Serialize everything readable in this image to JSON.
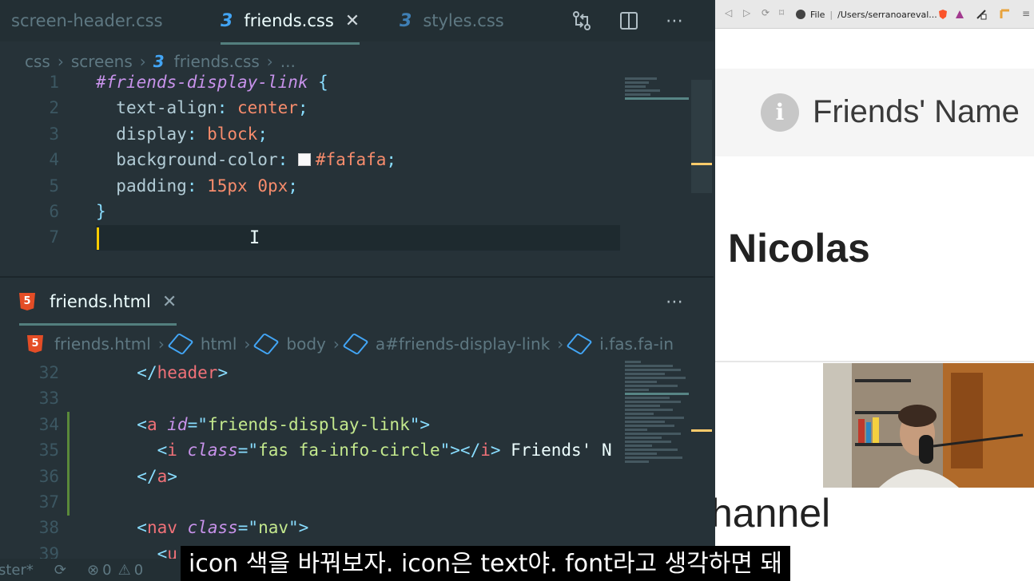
{
  "editor": {
    "tabs": [
      {
        "label": "screen-header.css",
        "active": false
      },
      {
        "label": "friends.css",
        "active": true
      },
      {
        "label": "styles.css",
        "active": false
      }
    ],
    "toolbar_icons": [
      "compare-icon",
      "split-editor-icon",
      "more-icon"
    ],
    "css_breadcrumb": [
      "css",
      "screens",
      "friends.css",
      "..."
    ],
    "css_lines": [
      {
        "n": "1",
        "parts": [
          [
            "sel",
            "#friends-display-link"
          ],
          [
            "pl",
            " "
          ],
          [
            "punc",
            "{"
          ]
        ]
      },
      {
        "n": "2",
        "parts": [
          [
            "pl",
            "  "
          ],
          [
            "prop",
            "text-align"
          ],
          [
            "punc",
            ": "
          ],
          [
            "val",
            "center"
          ],
          [
            "punc",
            ";"
          ]
        ]
      },
      {
        "n": "3",
        "parts": [
          [
            "pl",
            "  "
          ],
          [
            "prop",
            "display"
          ],
          [
            "punc",
            ": "
          ],
          [
            "val",
            "block"
          ],
          [
            "punc",
            ";"
          ]
        ]
      },
      {
        "n": "4",
        "parts": [
          [
            "pl",
            "  "
          ],
          [
            "prop",
            "background-color"
          ],
          [
            "punc",
            ": "
          ],
          [
            "swatch",
            ""
          ],
          [
            "val",
            "#fafafa"
          ],
          [
            "punc",
            ";"
          ]
        ]
      },
      {
        "n": "5",
        "parts": [
          [
            "pl",
            "  "
          ],
          [
            "prop",
            "padding"
          ],
          [
            "punc",
            ": "
          ],
          [
            "val",
            "15px 0px"
          ],
          [
            "punc",
            ";"
          ]
        ]
      },
      {
        "n": "6",
        "parts": [
          [
            "punc",
            "}"
          ]
        ]
      },
      {
        "n": "7",
        "parts": []
      }
    ],
    "html_panel_title": "friends.html",
    "html_breadcrumb": [
      "friends.html",
      "html",
      "body",
      "a#friends-display-link",
      "i.fas.fa-in"
    ],
    "html_lines": [
      {
        "n": "32",
        "parts": [
          [
            "pl",
            "  "
          ],
          [
            "punc",
            "</"
          ],
          [
            "tag",
            "header"
          ],
          [
            "punc",
            ">"
          ]
        ]
      },
      {
        "n": "33",
        "parts": []
      },
      {
        "n": "34",
        "parts": [
          [
            "pl",
            "  "
          ],
          [
            "punc",
            "<"
          ],
          [
            "tag",
            "a"
          ],
          [
            "pl",
            " "
          ],
          [
            "attr",
            "id"
          ],
          [
            "punc",
            "=\""
          ],
          [
            "str",
            "friends-display-link"
          ],
          [
            "punc",
            "\">"
          ]
        ]
      },
      {
        "n": "35",
        "parts": [
          [
            "pl",
            "    "
          ],
          [
            "punc",
            "<"
          ],
          [
            "tag",
            "i"
          ],
          [
            "pl",
            " "
          ],
          [
            "attr",
            "class"
          ],
          [
            "punc",
            "=\""
          ],
          [
            "str",
            "fas fa-info-circle"
          ],
          [
            "punc",
            "\"></"
          ],
          [
            "tag",
            "i"
          ],
          [
            "punc",
            ">"
          ],
          [
            "pl",
            " Friends' N"
          ]
        ]
      },
      {
        "n": "36",
        "parts": [
          [
            "pl",
            "  "
          ],
          [
            "punc",
            "</"
          ],
          [
            "tag",
            "a"
          ],
          [
            "punc",
            ">"
          ]
        ]
      },
      {
        "n": "37",
        "parts": []
      },
      {
        "n": "38",
        "parts": [
          [
            "pl",
            "  "
          ],
          [
            "punc",
            "<"
          ],
          [
            "tag",
            "nav"
          ],
          [
            "pl",
            " "
          ],
          [
            "attr",
            "class"
          ],
          [
            "punc",
            "=\""
          ],
          [
            "str",
            "nav"
          ],
          [
            "punc",
            "\">"
          ]
        ]
      },
      {
        "n": "39",
        "parts": [
          [
            "pl",
            "    "
          ],
          [
            "punc",
            "<"
          ],
          [
            "tag",
            "u"
          ]
        ]
      }
    ],
    "status": {
      "left": "ster*",
      "errors": "0",
      "warnings": "0"
    }
  },
  "browser": {
    "address": "/Users/serranoareval...",
    "file_label": "File",
    "link_text": "Friends' Name",
    "heading": "Nicolas",
    "channel_text": "hannel"
  },
  "subtitle": "icon 색을 바꿔보자. icon은 text야. font라고 생각하면 돼"
}
